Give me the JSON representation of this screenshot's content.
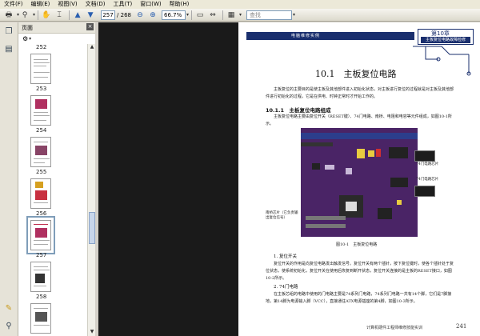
{
  "menu": [
    "文件(F)",
    "编辑(E)",
    "视图(V)",
    "文档(D)",
    "工具(T)",
    "窗口(W)",
    "帮助(H)"
  ],
  "toolbar": {
    "page_current": "257",
    "page_total": "/ 268",
    "zoom": "66.7%",
    "search_placeholder": "查找"
  },
  "panel": {
    "title": "页面"
  },
  "thumbnails": [
    {
      "label": "252"
    },
    {
      "label": "253"
    },
    {
      "label": "254"
    },
    {
      "label": "255"
    },
    {
      "label": "256"
    },
    {
      "label": "257"
    },
    {
      "label": "258"
    }
  ],
  "document": {
    "header_band": "电脑维修实例",
    "chapter": "第10章",
    "chapter_subtitle": "主板复位电路故障检修",
    "section_title": "10.1　主板复位电路",
    "intro": "主板复位的主要目的是使主板及其他部件进入初始化状态，对主板进行复位的过程就是对主板及其他部件进行初始化的过程，它是在供电、时钟正常时才开始工作的。",
    "subsection": "10.1.1　主板复位电路组成",
    "subsection_text": "主板复位电路主要由复位开关（RESET键）、74门电路、南桥、电阻和电容等元件组成，如图10-1所示。",
    "callout_left": "南桥芯片（它负责输出复位信号）",
    "callout_right_1": "74门电路芯片",
    "callout_right_2": "74门电路芯片",
    "figure_caption": "图10-1　主板复位电路",
    "item1_title": "1. 复位开关",
    "item1_text": "复位开关的作用是向复位电路发出触发信号。复位开关有两个插针，按下复位键时，使各个插针处于复位状态，使系统初始化，复位开关在使用后恢复到断开状态，复位开关连接的是主板的RESET接口，如图10-2所示。",
    "item2_title": "2. 74门电路",
    "item2_text": "在主板芯组的电路中使用的门电路主要是74系列门电路，74系列门电路一共有14个脚，它们是7脚接地，第14脚为电源输入脚（VCC），直接通往ATX电源插座的第4脚，如图10-3所示。",
    "footer_text": "计算机硬件工程师维修技能实训",
    "page_number": "241"
  }
}
